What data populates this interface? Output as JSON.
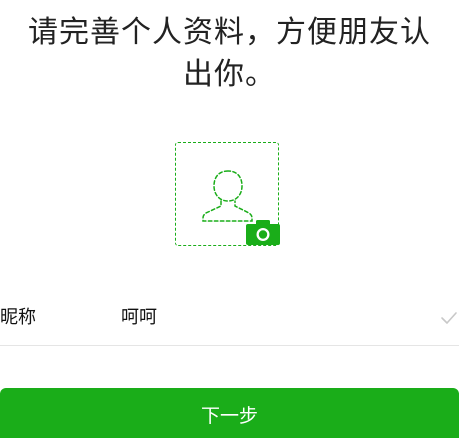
{
  "header": {
    "title_line1": "请完善个人资料，方便朋友认",
    "title_line2": "出你。"
  },
  "avatar": {
    "placeholder_icon": "person-outline-icon",
    "camera_icon": "camera-icon"
  },
  "form": {
    "nickname_label": "昵称",
    "nickname_value": "呵呵",
    "confirm_icon": "check-icon"
  },
  "actions": {
    "next_label": "下一步"
  },
  "colors": {
    "accent": "#1aad19",
    "divider": "#e5e5e5",
    "text": "#111111",
    "check": "#c8c8c8"
  }
}
